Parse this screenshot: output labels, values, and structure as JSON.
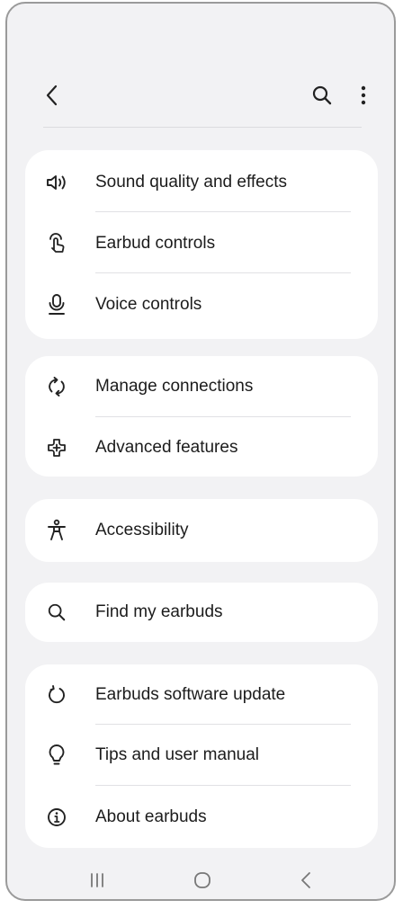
{
  "header": {
    "back_icon": "chevron-left-icon",
    "search_icon": "search-icon",
    "more_icon": "more-vertical-icon"
  },
  "groups": [
    {
      "items": [
        {
          "label": "Sound quality and effects",
          "icon": "speaker-icon"
        },
        {
          "label": "Earbud controls",
          "icon": "touch-icon"
        },
        {
          "label": "Voice controls",
          "icon": "microphone-icon"
        }
      ]
    },
    {
      "items": [
        {
          "label": "Manage connections",
          "icon": "sync-icon"
        },
        {
          "label": "Advanced features",
          "icon": "puzzle-plus-icon"
        }
      ]
    },
    {
      "items": [
        {
          "label": "Accessibility",
          "icon": "accessibility-icon"
        }
      ]
    },
    {
      "items": [
        {
          "label": "Find my earbuds",
          "icon": "search-icon"
        }
      ]
    },
    {
      "items": [
        {
          "label": "Earbuds software update",
          "icon": "update-icon"
        },
        {
          "label": "Tips and user manual",
          "icon": "lightbulb-icon"
        },
        {
          "label": "About earbuds",
          "icon": "info-icon"
        }
      ]
    }
  ],
  "navbar": {
    "recents_icon": "recents-icon",
    "home_icon": "home-icon",
    "back_icon": "back-icon"
  },
  "colors": {
    "background": "#f2f2f4",
    "card": "#ffffff",
    "text": "#1c1c1c"
  }
}
